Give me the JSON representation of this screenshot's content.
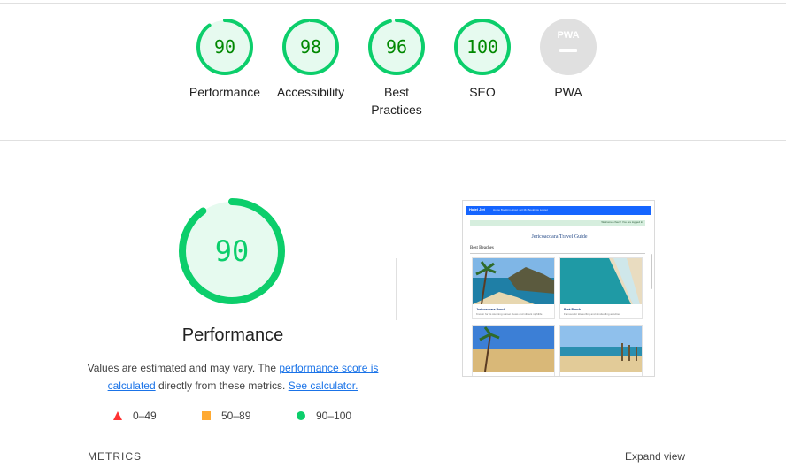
{
  "categories": [
    {
      "label": "Performance",
      "score": "90",
      "fraction": 0.9,
      "color": "#0cce6b",
      "text_color": "#008800",
      "bg": "#e6faef"
    },
    {
      "label": "Accessibility",
      "score": "98",
      "fraction": 0.98,
      "color": "#0cce6b",
      "text_color": "#008800",
      "bg": "#e6faef"
    },
    {
      "label": "Best Practices",
      "score": "96",
      "fraction": 0.96,
      "color": "#0cce6b",
      "text_color": "#008800",
      "bg": "#e6faef"
    },
    {
      "label": "SEO",
      "score": "100",
      "fraction": 1.0,
      "color": "#0cce6b",
      "text_color": "#008800",
      "bg": "#e6faef"
    }
  ],
  "pwa": {
    "label": "PWA",
    "badge_text": "PWA",
    "color": "#e0e0e0"
  },
  "performance": {
    "score": "90",
    "fraction": 0.9,
    "title": "Performance",
    "desc_prefix": "Values are estimated and may vary. The ",
    "link_score": "performance score is calculated",
    "desc_middle": " directly from these metrics. ",
    "link_calc": "See calculator."
  },
  "legend": [
    {
      "range": "0–49",
      "shape": "triangle-icon",
      "color": "#ff3333"
    },
    {
      "range": "50–89",
      "shape": "square-icon",
      "color": "#ffaa33"
    },
    {
      "range": "90–100",
      "shape": "circle-icon",
      "color": "#0cce6b"
    }
  ],
  "metrics_label": "METRICS",
  "expand_label": "Expand view",
  "preview": {
    "brand": "Hotel Jeri",
    "nav_links": "Home   Booking   About Jeri   My Bookings   Logout",
    "alert": "Welcome, check! You are logged in.",
    "title": "Jericoacoara Travel Guide",
    "section": "Best Beaches",
    "cards": [
      {
        "name": "Jericoacoara Beach",
        "text": "Known for its stunning sunset views and vibrant nightlife"
      },
      {
        "name": "Preá Beach",
        "text": "Famous for kitesurfing and windsurfing activities"
      },
      {
        "name": "",
        "text": ""
      },
      {
        "name": "",
        "text": ""
      }
    ]
  }
}
